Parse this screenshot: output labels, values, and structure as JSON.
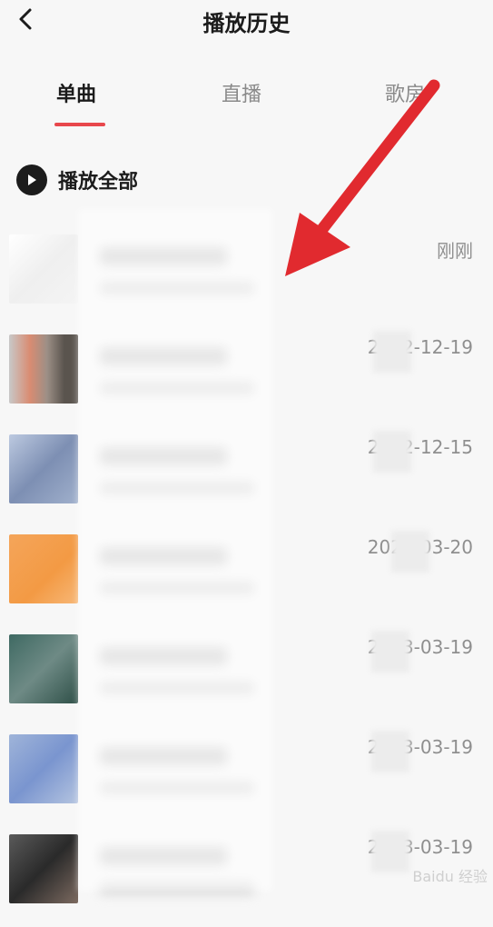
{
  "header": {
    "title": "播放历史",
    "back_icon": "chevron-left-icon"
  },
  "tabs": [
    {
      "label": "单曲",
      "active": true
    },
    {
      "label": "直播",
      "active": false
    },
    {
      "label": "歌房",
      "active": false
    }
  ],
  "play_all": {
    "label": "播放全部",
    "icon": "play-circle-icon"
  },
  "list": [
    {
      "date": "刚刚"
    },
    {
      "date": "2022-12-19"
    },
    {
      "date": "2022-12-15"
    },
    {
      "date": "2023-03-20"
    },
    {
      "date": "2023-03-19"
    },
    {
      "date": "2023-03-19"
    },
    {
      "date": "2023-03-19"
    }
  ],
  "colors": {
    "accent": "#e8474c",
    "arrow": "#e12a2f"
  },
  "watermark": "Baidu 经验"
}
